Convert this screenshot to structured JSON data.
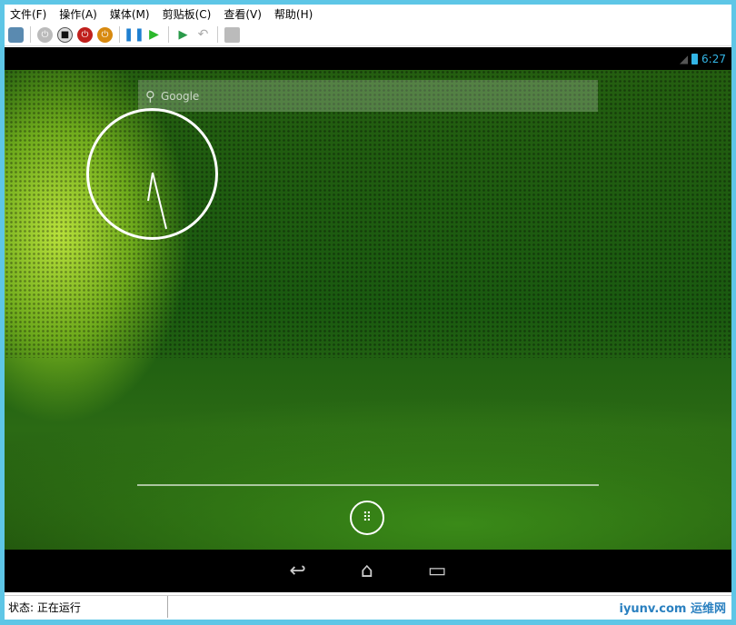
{
  "menu": [
    "文件(F)",
    "操作(A)",
    "媒体(M)",
    "剪贴板(C)",
    "查看(V)",
    "帮助(H)"
  ],
  "android": {
    "time": "6:27",
    "search_placeholder": "Google"
  },
  "status": {
    "text": "状态: 正在运行"
  },
  "watermark": "iyunv.com 运维网",
  "colors": {
    "accent": "#33b5e5",
    "border": "#5ec6e6"
  }
}
